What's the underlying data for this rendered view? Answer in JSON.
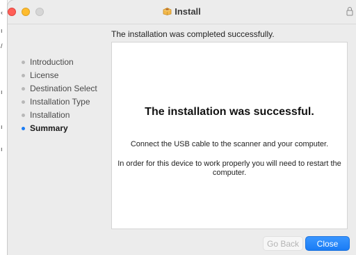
{
  "window": {
    "title": "Install",
    "icons": {
      "package": "package-icon",
      "lock": "lock-icon"
    }
  },
  "status_text": "The installation was completed successfully.",
  "sidebar": {
    "steps": [
      {
        "label": "Introduction",
        "active": false
      },
      {
        "label": "License",
        "active": false
      },
      {
        "label": "Destination Select",
        "active": false
      },
      {
        "label": "Installation Type",
        "active": false
      },
      {
        "label": "Installation",
        "active": false
      },
      {
        "label": "Summary",
        "active": true
      }
    ]
  },
  "content": {
    "headline": "The installation was successful.",
    "message_1": "Connect the USB cable to the scanner and your computer.",
    "message_2": "In order for this device to work properly you will need to restart the computer."
  },
  "buttons": {
    "back_label": "Go Back",
    "close_label": "Close"
  },
  "colors": {
    "accent": "#1a7cf5",
    "traffic_close": "#ff5f57",
    "traffic_minimize": "#febc2e",
    "traffic_zoom": "#d6d6d6"
  }
}
